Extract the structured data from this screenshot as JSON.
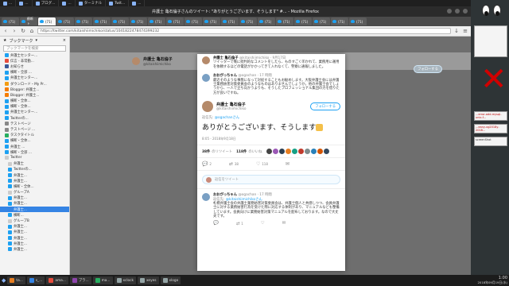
{
  "window": {
    "title": "弁護士 亀石倫子さんのツイート: \"ありがとうございます、そうします\" #... - Mozilla Firefox"
  },
  "top_strip": [
    "...",
    "...",
    "ブログ...",
    "...",
    "ターミナル",
    "Twit...",
    "..."
  ],
  "tabs": [
    "(71)",
    "横断ト",
    "(71)",
    "(71)",
    "(71)",
    "(71)",
    "(71)",
    "(71)",
    "(71)",
    "(71)",
    "(71)",
    "(71)",
    "(71)",
    "(71)",
    "(71)",
    "(71)",
    "(71)",
    "(71)",
    "(71)",
    "(71)"
  ],
  "url": "https://twitter.com/kitaishiimichiko/status/1041822478474399232",
  "sidebar": {
    "title": "ブックマーク",
    "search_placeholder": "ブックマークを検索",
    "items": [
      {
        "label": "弁護士センター...",
        "color": "#1da1f2"
      },
      {
        "label": "伝言 - 非常勤...",
        "color": "#e74c3c"
      },
      {
        "label": "お知らせ",
        "color": "#3b5998"
      },
      {
        "label": "横断・全部 ...",
        "color": "#1da1f2"
      },
      {
        "label": "弁護士センター...",
        "color": "#1da1f2"
      },
      {
        "label": "ダウンロード・My Pr...",
        "color": "#f39c12"
      },
      {
        "label": "Blogger: 弁護士...",
        "color": "#f57c00"
      },
      {
        "label": "Blogger: 弁護士...",
        "color": "#f57c00"
      },
      {
        "label": "横断・全体...",
        "color": "#1da1f2"
      },
      {
        "label": "横断・全体...",
        "color": "#1da1f2"
      },
      {
        "label": "弁護士センター...",
        "color": "#1da1f2"
      },
      {
        "label": "Twitterの...",
        "color": "#1da1f2"
      },
      {
        "label": "テストページ",
        "color": "#888888"
      },
      {
        "label": "テストページ ...",
        "color": "#888888"
      },
      {
        "label": "タスクタイトル",
        "color": "#27ae60"
      },
      {
        "label": "横断・全体...",
        "color": "#1da1f2"
      },
      {
        "label": "弁護士 ...",
        "color": "#1da1f2"
      },
      {
        "label": "横断・全部 ...",
        "color": "#1da1f2"
      },
      {
        "label": "Twitter",
        "color": "#cccccc"
      },
      {
        "label": "弁護士",
        "color": "#cccccc"
      },
      {
        "label": "Twitterの...",
        "color": "#1da1f2"
      },
      {
        "label": "弁護士...",
        "color": "#1da1f2"
      },
      {
        "label": "弁護士...",
        "color": "#1da1f2"
      },
      {
        "label": "横断・全体...",
        "color": "#1da1f2"
      },
      {
        "label": "グループA",
        "color": "#cccccc"
      },
      {
        "label": "弁護士...",
        "color": "#1da1f2"
      },
      {
        "label": "弁護士...",
        "color": "#1da1f2"
      },
      {
        "label": "弁護士...",
        "color": "#3584e4",
        "selected": true
      },
      {
        "label": "横断...",
        "color": "#1da1f2"
      },
      {
        "label": "グループB",
        "color": "#cccccc"
      },
      {
        "label": "弁護士...",
        "color": "#1da1f2"
      },
      {
        "label": "弁護士...",
        "color": "#1da1f2"
      },
      {
        "label": "弁護士...",
        "color": "#1da1f2"
      },
      {
        "label": "弁護士...",
        "color": "#1da1f2"
      },
      {
        "label": "弁護士...",
        "color": "#1da1f2"
      }
    ]
  },
  "background_profile": {
    "name": "弁護士 亀石倫子",
    "handle": "@kitaishiimichiko",
    "follow_label": "フォローする"
  },
  "modal": {
    "thread": [
      {
        "name": "弁護士 亀石倫子",
        "handle": "@kitaishiimichiko · 9月17日",
        "text": "ツイッターで俺に批判的なコメントをしたら、ものすごく叩かれて、業務用に運用を依頼するほどの電話がかかってきて入れなくて、警察に通報しました。",
        "avatar_color": "#b58a6a"
      },
      {
        "name": "おおがっちゃん",
        "handle": "@ogachan · 17 時間",
        "text": "最近そのような事態になって対処することもお勧めします。大阪弁護士会には弁護士業務妨害対策委員会のようなものはありませんでしょうか。他の弁護士会でしょうから、一人で立ち向かうよりも、そうしたプロフェッショナル集団の力を借りた方が良いですね。",
        "avatar_color": "#7aa0c4"
      }
    ],
    "main": {
      "name": "弁護士 亀石倫子",
      "handle": "@kitaishiimichiko",
      "follow_label": "フォローする",
      "reply_prefix": "返信先:",
      "reply_to": "@ogachanさん",
      "text": "ありがとうございます、そうします",
      "time": "8:05 - 2018年9月18日",
      "retweets_count": "38件",
      "retweets_label": "のリツイート",
      "likes_count": "118件",
      "likes_label": "のいいね",
      "likers": [
        "#444444",
        "#9b59b6",
        "#2c3e50",
        "#e67e22",
        "#16a085",
        "#c0392b",
        "#7f8c8d",
        "#2980b9",
        "#d35400",
        "#34495e"
      ],
      "action_counts": [
        "2",
        "38",
        "118"
      ]
    },
    "reply_placeholder": "返信をツイート",
    "reply2": {
      "name": "おおがっちゃん",
      "handle": "@ogachan · 17 時間",
      "reply_to": "@kitaishiimichikoさん",
      "text": "札幌弁護士会の弁護士業務妨害対策委員会は、弁護士個人と共感しつつ、会員弁護士に対する業務妨害行為を受けた際に対応する体制があり、マニュアルなども整備しています。会員向けに業務妨害対策マニュアルを配布しております。なので大丈夫です。",
      "counts": [
        "",
        "1",
        ""
      ]
    }
  },
  "taskbar": {
    "items": [
      "ta...",
      "s_...",
      "ama...",
      "ブラ...",
      "ma...",
      "xclock",
      "xeyes",
      "xlogo"
    ],
    "clock_time": "1:00",
    "clock_date": "2018年09月19日(水)"
  },
  "right_panel_snippets": [
    "...error-add-mysql-unix-f...",
    "...eany-xg2018y-2018...",
    "screenShot"
  ]
}
